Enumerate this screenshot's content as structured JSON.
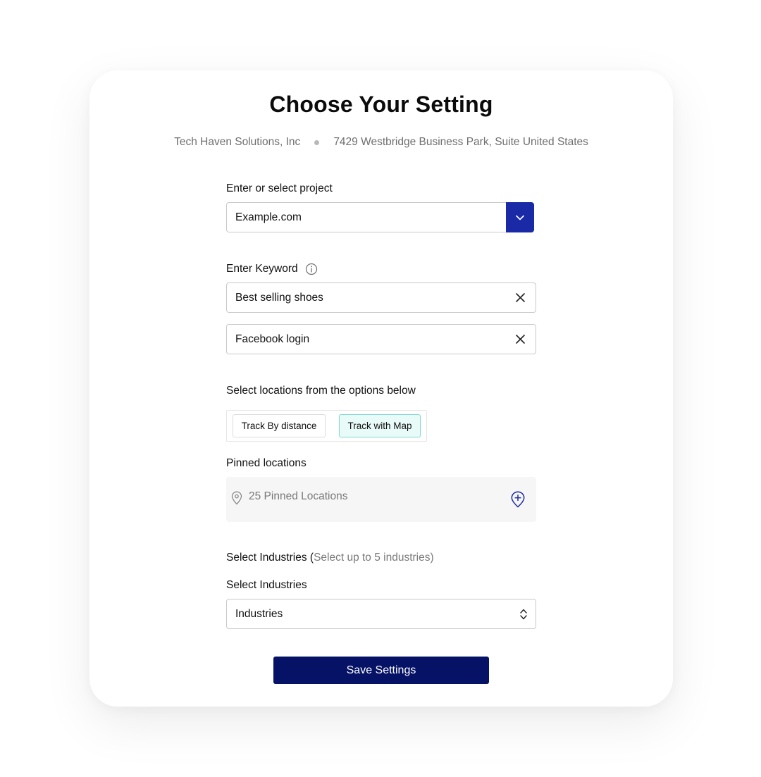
{
  "header": {
    "title": "Choose Your Setting",
    "company": "Tech Haven Solutions, Inc",
    "address": "7429 Westbridge Business Park, Suite United States"
  },
  "project": {
    "label": "Enter or select project",
    "value": "Example.com"
  },
  "keywords": {
    "label": "Enter Keyword",
    "items": [
      "Best selling shoes",
      "Facebook login"
    ]
  },
  "locations": {
    "label": "Select locations from the options below",
    "options": [
      "Track By distance",
      "Track with Map"
    ],
    "selected": "Track with Map"
  },
  "pinned": {
    "label": "Pinned locations",
    "summary": "25 Pinned Locations"
  },
  "industries": {
    "heading": "Select Industries (",
    "heading_hint": "Select up to 5 industries)",
    "label": "Select Industries",
    "value": "Industries"
  },
  "actions": {
    "save_label": "Save Settings"
  },
  "colors": {
    "primary": "#061266",
    "dropdown_button": "#1a2aa6",
    "selected_toggle_bg": "#e9fbf8",
    "selected_toggle_border": "#7fd9cf"
  }
}
